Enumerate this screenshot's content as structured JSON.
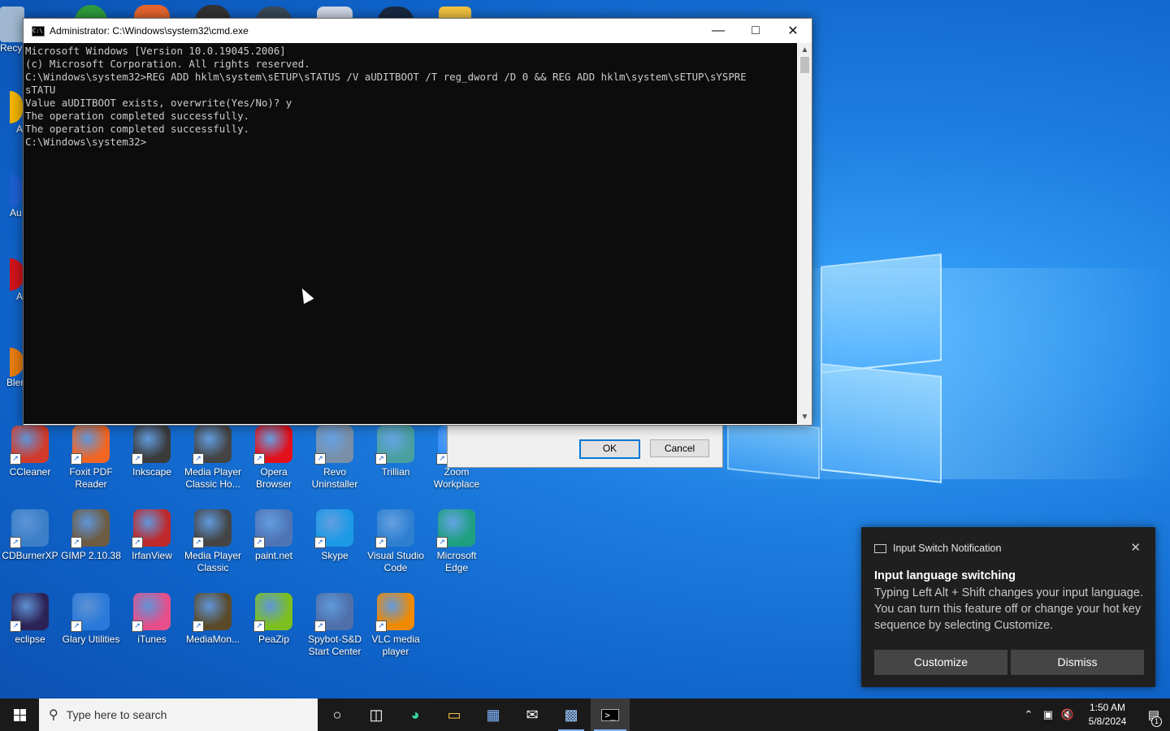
{
  "cmd": {
    "title": "Administrator: C:\\Windows\\system32\\cmd.exe",
    "lines": [
      "Microsoft Windows [Version 10.0.19045.2006]",
      "(c) Microsoft Corporation. All rights reserved.",
      "",
      "C:\\Windows\\system32>REG ADD hklm\\system\\sETUP\\sTATUS /V aUDITBOOT /T reg_dword /D 0 && REG ADD hklm\\system\\sETUP\\sYSPRE",
      "sTATU",
      "Value aUDITBOOT exists, overwrite(Yes/No)? y",
      "The operation completed successfully.",
      "The operation completed successfully.",
      "",
      "C:\\Windows\\system32>"
    ]
  },
  "dialog": {
    "ok": "OK",
    "cancel": "Cancel"
  },
  "desktop_icons": [
    {
      "label": "CCleaner",
      "color": "#d23b2b"
    },
    {
      "label": "Foxit PDF Reader",
      "color": "#f26522"
    },
    {
      "label": "Inkscape",
      "color": "#3b3b3b"
    },
    {
      "label": "Media Player Classic Ho...",
      "color": "#444444"
    },
    {
      "label": "Opera Browser",
      "color": "#e3101c"
    },
    {
      "label": "Revo Uninstaller",
      "color": "#7a8fa8"
    },
    {
      "label": "Trillian",
      "color": "#4aa0a0"
    },
    {
      "label": "Zoom Workplace",
      "color": "#2d8cff"
    },
    {
      "label": "CDBurnerXP",
      "color": "#3a7fc8"
    },
    {
      "label": "GIMP 2.10.38",
      "color": "#6d5b42"
    },
    {
      "label": "IrfanView",
      "color": "#c0282a"
    },
    {
      "label": "Media Player Classic",
      "color": "#444444"
    },
    {
      "label": "paint.net",
      "color": "#4e74b6"
    },
    {
      "label": "Skype",
      "color": "#1c9ae6"
    },
    {
      "label": "Visual Studio Code",
      "color": "#2f7fd0"
    },
    {
      "label": "Microsoft Edge",
      "color": "#1fa080"
    },
    {
      "label": "eclipse",
      "color": "#2c2255"
    },
    {
      "label": "Glary Utilities",
      "color": "#2b7ad9"
    },
    {
      "label": "iTunes",
      "color": "#e64f8a"
    },
    {
      "label": "MediaMon...",
      "color": "#5a4a2a"
    },
    {
      "label": "PeaZip",
      "color": "#7cbf1e"
    },
    {
      "label": "Spybot-S&D Start Center",
      "color": "#4e6fa8"
    },
    {
      "label": "VLC media player",
      "color": "#f08a00"
    }
  ],
  "partial_icons": [
    "Recy",
    "A",
    "Au",
    "A",
    "Bler"
  ],
  "toast": {
    "header": "Input Switch Notification",
    "title": "Input language switching",
    "body": "Typing Left Alt + Shift changes your input language. You can turn this feature off or change your hot key sequence by selecting Customize.",
    "customize": "Customize",
    "dismiss": "Dismiss"
  },
  "taskbar": {
    "search_placeholder": "Type here to search",
    "time": "1:50 AM",
    "date": "5/8/2024",
    "notification_count": "1"
  }
}
